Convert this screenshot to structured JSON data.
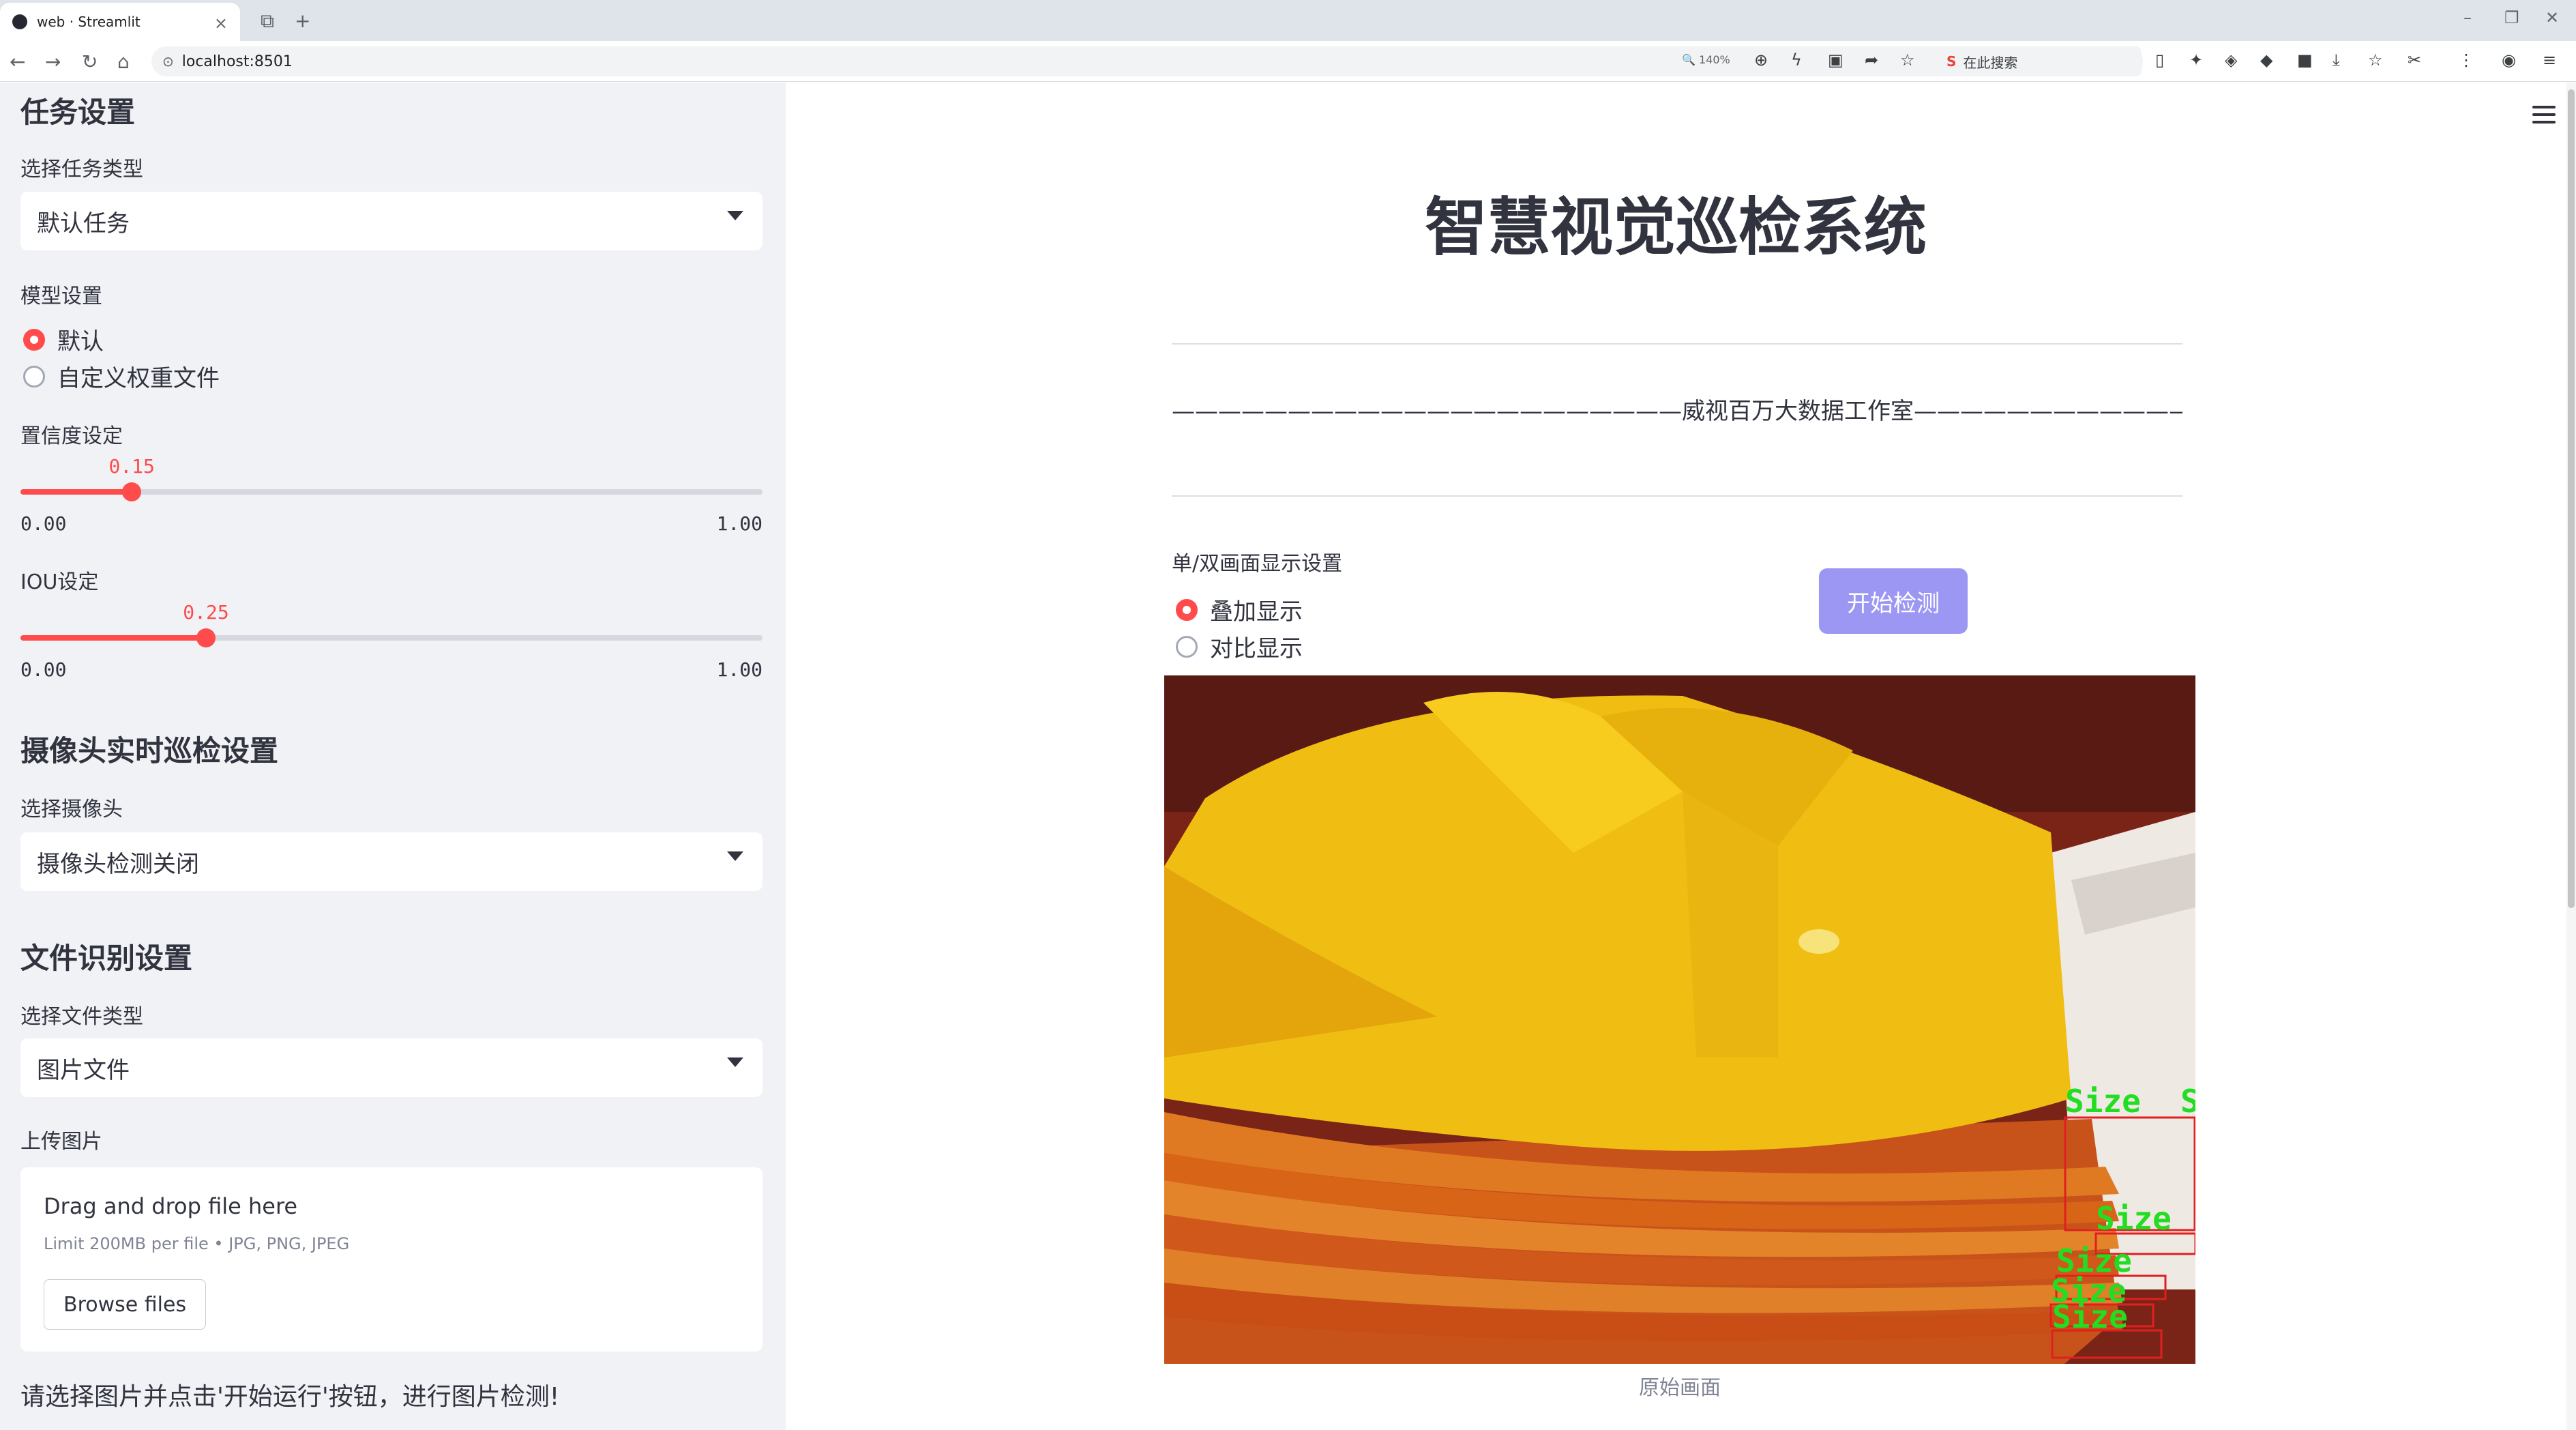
{
  "browser": {
    "tab_title": "web · Streamlit",
    "url": "localhost:8501",
    "zoom": "140%",
    "search_placeholder": "在此搜索"
  },
  "sidebar": {
    "task_header": "任务设置",
    "task_type_label": "选择任务类型",
    "task_type_value": "默认任务",
    "model_label": "模型设置",
    "model_options": [
      "默认",
      "自定义权重文件"
    ],
    "model_selected": 0,
    "conf_label": "置信度设定",
    "conf_value": "0.15",
    "conf_fraction": 0.15,
    "conf_min": "0.00",
    "conf_max": "1.00",
    "iou_label": "IOU设定",
    "iou_value": "0.25",
    "iou_fraction": 0.25,
    "iou_min": "0.00",
    "iou_max": "1.00",
    "camera_header": "摄像头实时巡检设置",
    "camera_label": "选择摄像头",
    "camera_value": "摄像头检测关闭",
    "file_header": "文件识别设置",
    "file_type_label": "选择文件类型",
    "file_type_value": "图片文件",
    "upload_label": "上传图片",
    "upload_drag": "Drag and drop file here",
    "upload_limit": "Limit 200MB per file • JPG, PNG, JPEG",
    "upload_button": "Browse files",
    "hint": "请选择图片并点击'开始运行'按钮，进行图片检测!"
  },
  "main": {
    "title": "智慧视觉巡检系统",
    "subtitle": "——————————————————————威视百万大数据工作室———————————————————————",
    "display_label": "单/双画面显示设置",
    "display_options": [
      "叠加显示",
      "对比显示"
    ],
    "display_selected": 0,
    "start_button": "开始检测",
    "image_caption": "原始画面",
    "detection_label": "Size"
  },
  "colors": {
    "accent": "#ff4b4b",
    "button": "#9d97f4",
    "detection_box": "#e02020",
    "detection_text": "#22dd22"
  }
}
